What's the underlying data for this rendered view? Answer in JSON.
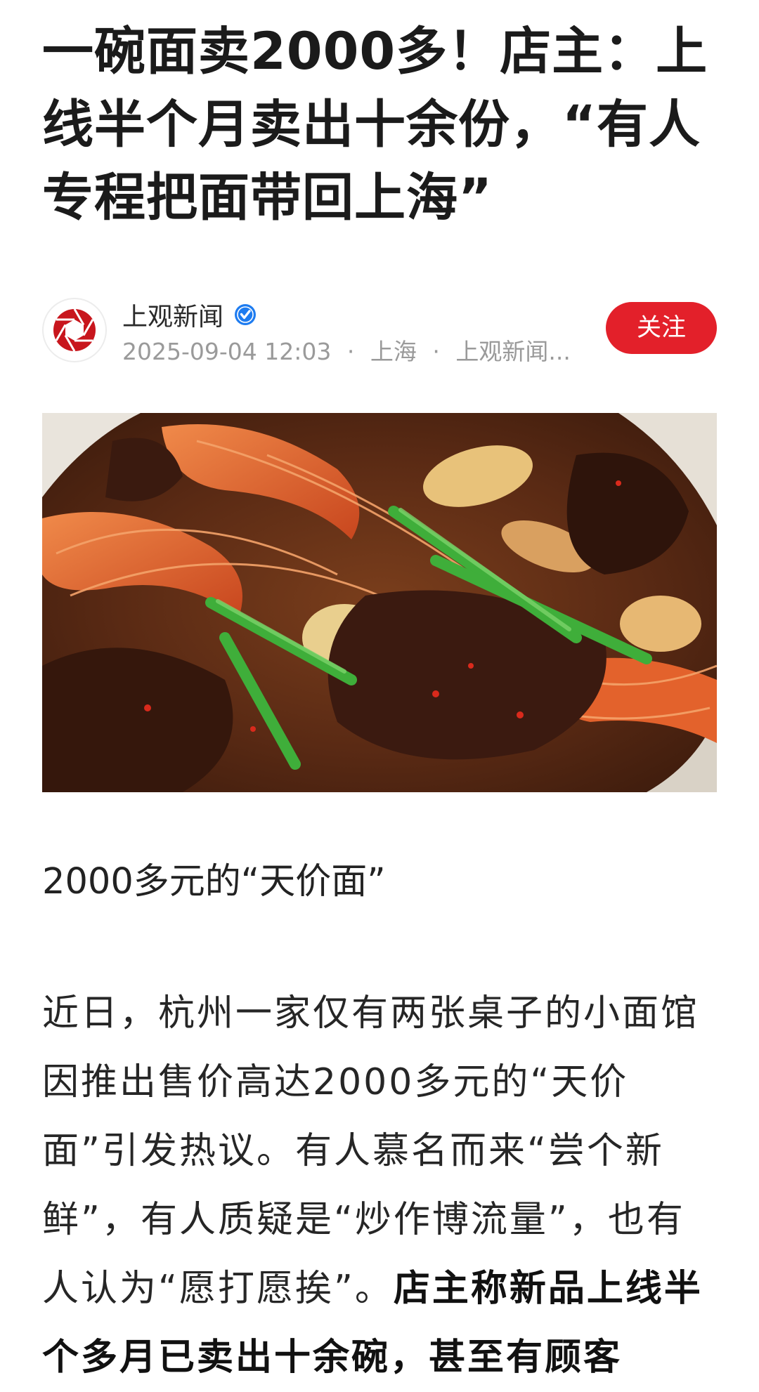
{
  "article": {
    "headline": "一碗面卖2000多！店主：上线半个月卖出十余份，“有人专程把面带回上海”",
    "image_caption": "2000多元的“天价面”",
    "body_regular": "近日，杭州一家仅有两张桌子的小面馆因推出售价高达2000多元的“天价面”引发热议。有人慕名而来“尝个新鲜”，有人质疑是“炒作博流量”，也有人认为“愿打愿挨”。",
    "body_bold": "店主称新品上线半个多月已卖出十余碗，甚至有顾客"
  },
  "source": {
    "name": "上观新闻",
    "date": "2025-09-04 12:03",
    "location": "上海",
    "outlet_truncated": "上观新闻...",
    "separator": "·",
    "follow_label": "关注",
    "logo_icon": "shutter-aperture-icon",
    "verified_icon": "verified-check-icon",
    "logo_color": "#c8161d",
    "follow_color": "#e3202a",
    "verified_color": "#1e7cf0"
  },
  "hero_image": {
    "subject": "stir-fried noodle dish photo"
  }
}
